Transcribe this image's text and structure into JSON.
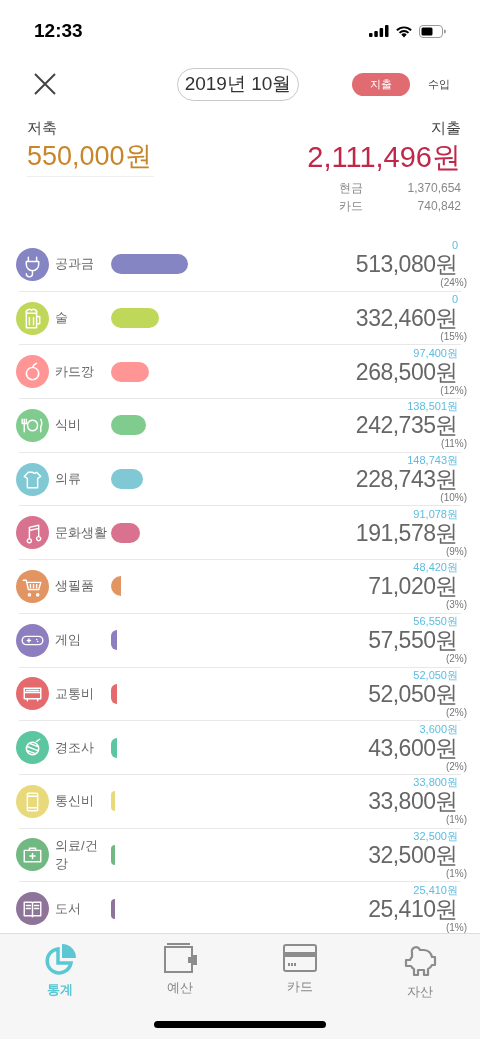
{
  "status_bar": {
    "time": "12:33"
  },
  "header": {
    "month": "2019년 10월",
    "segments": [
      {
        "label": "지출",
        "selected": true
      },
      {
        "label": "수입",
        "selected": false
      }
    ]
  },
  "summary": {
    "savings_label": "저축",
    "savings": "550,000원",
    "expense_label": "지출",
    "expense": "2,111,496원",
    "breakdown": [
      {
        "label": "현금",
        "value": "1,370,654"
      },
      {
        "label": "카드",
        "value": "740,842"
      }
    ]
  },
  "categories": [
    {
      "name": "공과금",
      "color": "#8585c4",
      "budget": "0",
      "amount": "513,080원",
      "share": "(24%)"
    },
    {
      "name": "술",
      "color": "#bfd85a",
      "budget": "0",
      "amount": "332,460원",
      "share": "(15%)"
    },
    {
      "name": "카드깡",
      "color": "#ff9595",
      "budget": "97,400원",
      "amount": "268,500원",
      "share": "(12%)"
    },
    {
      "name": "식비",
      "color": "#80cc8f",
      "budget": "138,501원",
      "amount": "242,735원",
      "share": "(11%)"
    },
    {
      "name": "의류",
      "color": "#80c9d4",
      "budget": "148,743원",
      "amount": "228,743원",
      "share": "(10%)"
    },
    {
      "name": "문화생활",
      "color": "#d9728e",
      "budget": "91,078원",
      "amount": "191,578원",
      "share": "(9%)"
    },
    {
      "name": "생필품",
      "color": "#e39463",
      "budget": "48,420원",
      "amount": "71,020원",
      "share": "(3%)"
    },
    {
      "name": "게임",
      "color": "#8d7fbf",
      "budget": "56,550원",
      "amount": "57,550원",
      "share": "(2%)"
    },
    {
      "name": "교통비",
      "color": "#e56a6e",
      "budget": "52,050원",
      "amount": "52,050원",
      "share": "(2%)"
    },
    {
      "name": "경조사",
      "color": "#5cc6a0",
      "budget": "3,600원",
      "amount": "43,600원",
      "share": "(2%)"
    },
    {
      "name": "통신비",
      "color": "#e8d97a",
      "budget": "33,800원",
      "amount": "33,800원",
      "share": "(1%)"
    },
    {
      "name": "의료/건강",
      "color": "#72b883",
      "budget": "32,500원",
      "amount": "32,500원",
      "share": "(1%)"
    },
    {
      "name": "도서",
      "color": "#8e7499",
      "budget": "25,410원",
      "amount": "25,410원",
      "share": "(1%)"
    }
  ],
  "tabs": [
    {
      "label": "통계",
      "selected": true
    },
    {
      "label": "예산",
      "selected": false
    },
    {
      "label": "카드",
      "selected": false
    },
    {
      "label": "자산",
      "selected": false
    }
  ]
}
